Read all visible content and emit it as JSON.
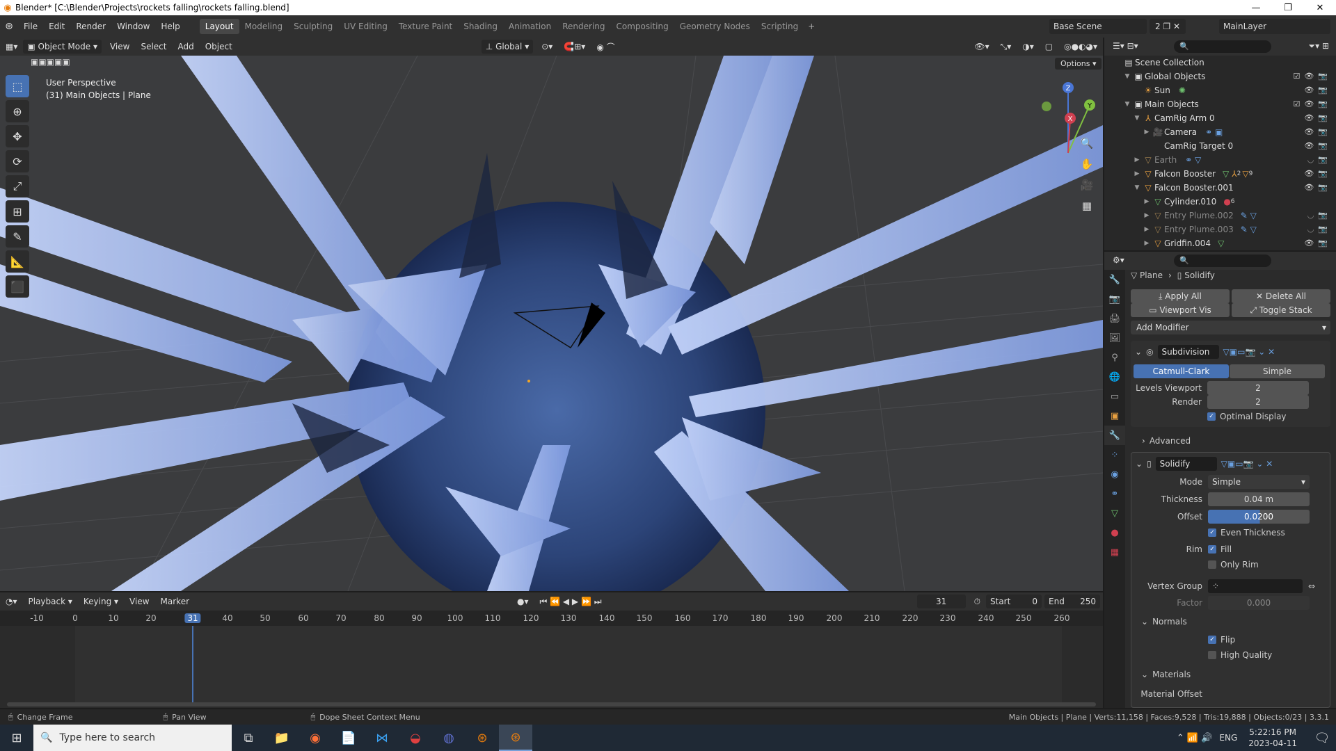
{
  "titlebar": {
    "title": "Blender* [C:\\Blender\\Projects\\rockets falling\\rockets falling.blend]",
    "minimize": "—",
    "maximize": "❐",
    "close": "✕"
  },
  "menu": [
    "File",
    "Edit",
    "Render",
    "Window",
    "Help"
  ],
  "workspaces": [
    "Layout",
    "Modeling",
    "Sculpting",
    "UV Editing",
    "Texture Paint",
    "Shading",
    "Animation",
    "Rendering",
    "Compositing",
    "Geometry Nodes",
    "Scripting"
  ],
  "scene": {
    "name": "Base Scene",
    "count": "2",
    "view_layer": "MainLayer"
  },
  "viewport_header": {
    "mode": "Object Mode",
    "view": "View",
    "select": "Select",
    "add": "Add",
    "object": "Object",
    "orientation": "Global",
    "options": "Options"
  },
  "viewport": {
    "perspective": "User Perspective",
    "context": "(31) Main Objects | Plane",
    "gizmo_x": "X",
    "gizmo_y": "Y",
    "gizmo_z": "Z"
  },
  "timeline": {
    "playback": "Playback",
    "keying": "Keying",
    "view": "View",
    "marker": "Marker",
    "current_frame": "31",
    "start_label": "Start",
    "start": "0",
    "end_label": "End",
    "end": "250",
    "ticks": [
      "-10",
      "0",
      "10",
      "20",
      "31",
      "40",
      "50",
      "60",
      "70",
      "80",
      "90",
      "100",
      "110",
      "120",
      "130",
      "140",
      "150",
      "160",
      "170",
      "180",
      "190",
      "200",
      "210",
      "220",
      "230",
      "240",
      "250",
      "260"
    ]
  },
  "outliner": {
    "title": "Scene Collection",
    "rows": [
      {
        "label": "Global Objects",
        "indent": 1,
        "icon": "collection"
      },
      {
        "label": "Sun",
        "indent": 2,
        "icon": "light"
      },
      {
        "label": "Main Objects",
        "indent": 1,
        "icon": "collection"
      },
      {
        "label": "CamRig Arm 0",
        "indent": 2,
        "icon": "armature"
      },
      {
        "label": "Camera",
        "indent": 3,
        "icon": "camera"
      },
      {
        "label": "CamRig Target 0",
        "indent": 2,
        "icon": "empty"
      },
      {
        "label": "Earth",
        "indent": 2,
        "icon": "mesh"
      },
      {
        "label": "Falcon Booster",
        "indent": 2,
        "icon": "mesh"
      },
      {
        "label": "Falcon Booster.001",
        "indent": 2,
        "icon": "mesh"
      },
      {
        "label": "Cylinder.010",
        "indent": 3,
        "icon": "mesh"
      },
      {
        "label": "Entry Plume.002",
        "indent": 3,
        "icon": "mesh"
      },
      {
        "label": "Entry Plume.003",
        "indent": 3,
        "icon": "mesh"
      },
      {
        "label": "Gridfin.004",
        "indent": 3,
        "icon": "mesh"
      }
    ],
    "badges": {
      "falcon_a": "2",
      "falcon_b": "9",
      "cylinder": "6"
    }
  },
  "properties": {
    "breadcrumb_object": "Plane",
    "breadcrumb_modifier": "Solidify",
    "apply_all": "Apply All",
    "delete_all": "Delete All",
    "viewport_vis": "Viewport Vis",
    "toggle_stack": "Toggle Stack",
    "add_modifier": "Add Modifier",
    "subdivision": {
      "name": "Subdivision",
      "catmull": "Catmull-Clark",
      "simple": "Simple",
      "levels_label": "Levels Viewport",
      "levels": "2",
      "render_label": "Render",
      "render": "2",
      "optimal": "Optimal Display",
      "advanced": "Advanced"
    },
    "solidify": {
      "name": "Solidify",
      "mode_label": "Mode",
      "mode": "Simple",
      "thickness_label": "Thickness",
      "thickness": "0.04 m",
      "offset_label": "Offset",
      "offset": "0.0200",
      "even": "Even Thickness",
      "rim_label": "Rim",
      "fill": "Fill",
      "only_rim": "Only Rim",
      "vgroup_label": "Vertex Group",
      "factor_label": "Factor",
      "factor": "0.000",
      "normals": "Normals",
      "flip": "Flip",
      "hq": "High Quality",
      "materials": "Materials",
      "mat_offset": "Material Offset"
    }
  },
  "statusbar": {
    "change_frame": "Change Frame",
    "pan_view": "Pan View",
    "context_menu": "Dope Sheet Context Menu",
    "stats": "Main Objects | Plane | Verts:11,158 | Faces:9,528 | Tris:19,888 | Objects:0/23 | 3.3.1"
  },
  "taskbar": {
    "search": "Type here to search",
    "lang": "ENG",
    "time": "5:22:16 PM",
    "date": "2023-04-11"
  }
}
